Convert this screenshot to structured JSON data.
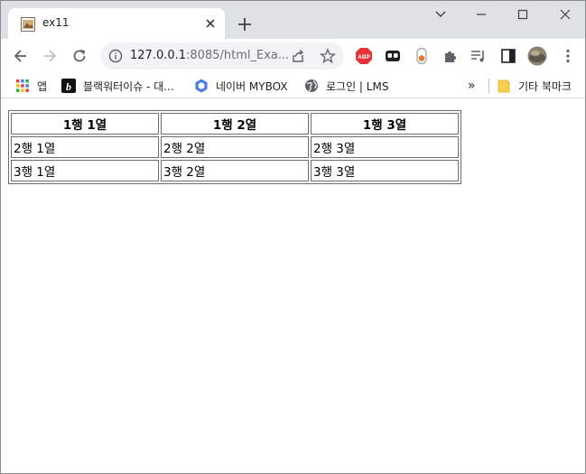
{
  "tab": {
    "title": "ex11"
  },
  "omnibox": {
    "url_host": "127.0.0.1",
    "url_path": ":8085/html_Exa..."
  },
  "bookmarks": {
    "items": [
      {
        "label": "앱",
        "icon": "apps-grid-icon"
      },
      {
        "label": "블랙워터이슈 - 대...",
        "icon": "b-logo-icon"
      },
      {
        "label": "네이버 MYBOX",
        "icon": "mybox-icon"
      },
      {
        "label": "로그인 | LMS",
        "icon": "globe-icon"
      }
    ],
    "overflow_label": "»",
    "other": {
      "label": "기타 북마크",
      "icon": "folder-icon"
    }
  },
  "table": {
    "headers": [
      "1행 1열",
      "1행 2열",
      "1행 3열"
    ],
    "rows": [
      [
        "2행 1열",
        "2행 2열",
        "2행 3열"
      ],
      [
        "3행 1열",
        "3행 2열",
        "3행 3열"
      ]
    ]
  },
  "colors": {
    "tabstrip": "#dee1e6",
    "abp_red": "#e8323a",
    "folder_yellow": "#f7d04f",
    "mybox_blue": "#4b7be8"
  }
}
